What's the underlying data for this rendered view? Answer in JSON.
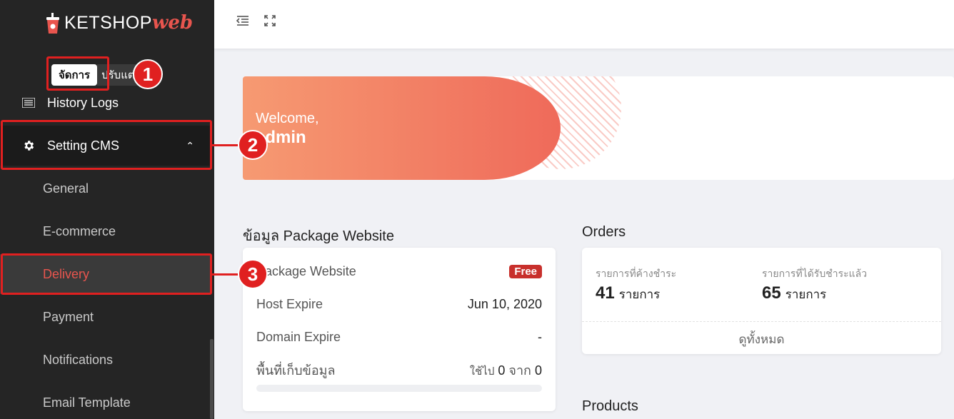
{
  "sidebar": {
    "logo": {
      "main": "KETSHOP",
      "accent": "web"
    },
    "mode": {
      "active": "จัดการ",
      "inactive": "ปรับแต่ง"
    },
    "items": [
      {
        "label": "History Logs",
        "icon": "list-icon"
      },
      {
        "label": "Setting CMS",
        "icon": "gear-icon"
      }
    ],
    "submenu": [
      "General",
      "E-commerce",
      "Delivery",
      "Payment",
      "Notifications",
      "Email Template"
    ]
  },
  "annotations": [
    "1",
    "2",
    "3"
  ],
  "topbar": {
    "icons": [
      "menu-collapse-icon",
      "fullscreen-icon"
    ]
  },
  "banner": {
    "line1": "Welcome,",
    "line2": "admin"
  },
  "package": {
    "title": "ข้อมูล Package Website",
    "rows": [
      {
        "label": "Package Website",
        "value": "Free"
      },
      {
        "label": "Host Expire",
        "value": "Jun 10, 2020"
      },
      {
        "label": "Domain Expire",
        "value": "-"
      },
      {
        "label": "พื้นที่เก็บข้อมูล",
        "value_prefix": "ใช้ไป",
        "used": "0",
        "sep": "จาก",
        "total": "0"
      }
    ],
    "storage_used_fraction": 0
  },
  "orders": {
    "title": "Orders",
    "pending_label": "รายการที่ค้างชำระ",
    "pending_count": "41",
    "pending_unit": "รายการ",
    "paid_label": "รายการที่ได้รับชำระแล้ว",
    "paid_count": "65",
    "paid_unit": "รายการ",
    "view_all": "ดูทั้งหมด"
  },
  "products": {
    "title": "Products"
  },
  "colors": {
    "accent": "#e8554e",
    "annotation": "#e02020",
    "sidebar_bg": "#252525"
  }
}
